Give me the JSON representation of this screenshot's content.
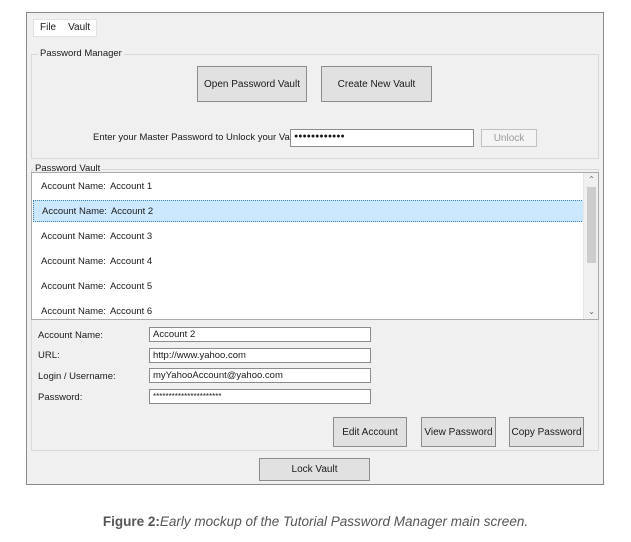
{
  "menu": {
    "file": "File",
    "vault": "Vault"
  },
  "password_manager": {
    "group_label": "Password Manager",
    "open_vault_button": "Open Password Vault",
    "create_vault_button": "Create New Vault",
    "master_prompt": "Enter your Master Password to Unlock your Vault",
    "master_password_value": "●●●●●●●●●●●●",
    "unlock_button": "Unlock"
  },
  "vault": {
    "group_label": "Password Vault",
    "row_key": "Account Name:",
    "accounts": [
      "Account 1",
      "Account 2",
      "Account 3",
      "Account 4",
      "Account 5",
      "Account 6"
    ],
    "selected_index": 1
  },
  "details": {
    "account_name_label": "Account Name:",
    "account_name_value": "Account 2",
    "url_label": "URL:",
    "url_value": "http://www.yahoo.com",
    "login_label": "Login / Username:",
    "login_value": "myYahooAccount@yahoo.com",
    "password_label": "Password:",
    "password_value": "**********************"
  },
  "actions": {
    "edit_account": "Edit Account",
    "view_password": "View Password",
    "copy_password": "Copy Password",
    "lock_vault": "Lock Vault"
  },
  "scrollbar": {
    "up_icon": "chevron-up-icon",
    "down_icon": "chevron-down-icon"
  },
  "caption": {
    "bold": "Figure 2:",
    "italic": "Early mockup of the Tutorial Password Manager main screen."
  },
  "colors": {
    "window_bg": "#f0f0f0",
    "selection_bg": "#cce8ff",
    "selection_border": "#3c7fb1"
  }
}
